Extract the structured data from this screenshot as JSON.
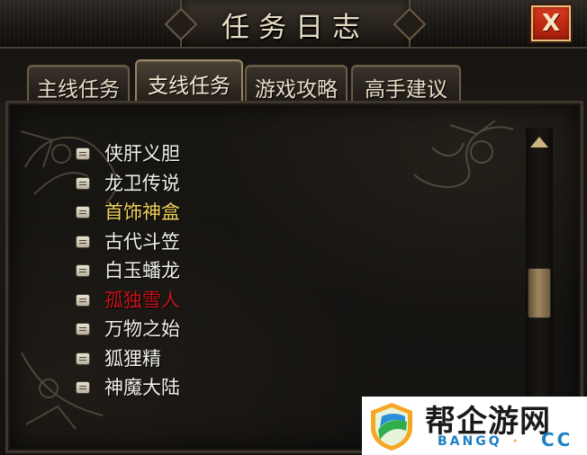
{
  "window": {
    "title": "任务日志",
    "close_label": "X"
  },
  "tabs": [
    {
      "label": "主线任务",
      "active": false
    },
    {
      "label": "支线任务",
      "active": true
    },
    {
      "label": "游戏攻略",
      "active": false
    },
    {
      "label": "高手建议",
      "active": false
    }
  ],
  "quests": [
    {
      "label": "侠肝义胆",
      "color": "#f2f0ea",
      "icon": "scroll-icon"
    },
    {
      "label": "龙卫传说",
      "color": "#f2f0ea",
      "icon": "scroll-icon"
    },
    {
      "label": "首饰神盒",
      "color": "#f0d25a",
      "icon": "scroll-icon"
    },
    {
      "label": "古代斗笠",
      "color": "#f2f0ea",
      "icon": "scroll-icon"
    },
    {
      "label": "白玉蟠龙",
      "color": "#f2f0ea",
      "icon": "scroll-icon"
    },
    {
      "label": "孤独雪人",
      "color": "#c8141b",
      "icon": "scroll-icon"
    },
    {
      "label": "万物之始",
      "color": "#f2f0ea",
      "icon": "scroll-icon"
    },
    {
      "label": "狐狸精",
      "color": "#f2f0ea",
      "icon": "scroll-icon"
    },
    {
      "label": "神魔大陆",
      "color": "#f2f0ea",
      "icon": "scroll-icon"
    }
  ],
  "scrollbar": {
    "up_icon": "triangle-up-icon",
    "position_fraction": 0.6
  },
  "watermark": {
    "title": "帮企游网",
    "subtitle": "BANGQ",
    "dot": "·",
    "domain": "CC"
  },
  "colors": {
    "accent_gold": "#cbb482",
    "close_red": "#c02a14",
    "highlight_yellow": "#f0d25a",
    "highlight_red": "#c8141b"
  }
}
